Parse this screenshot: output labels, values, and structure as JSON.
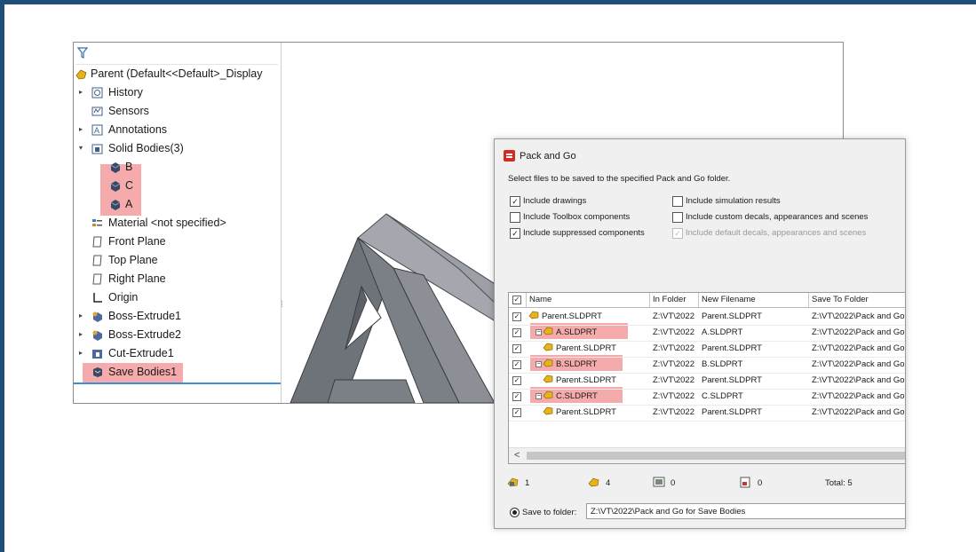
{
  "tree": {
    "parent_label": "Parent  (Default<<Default>_Display",
    "items": [
      {
        "label": "History"
      },
      {
        "label": "Sensors"
      },
      {
        "label": "Annotations"
      },
      {
        "label": "Solid Bodies(3)"
      },
      {
        "label": "B"
      },
      {
        "label": "C"
      },
      {
        "label": "A"
      },
      {
        "label": "Material <not specified>"
      },
      {
        "label": "Front Plane"
      },
      {
        "label": "Top Plane"
      },
      {
        "label": "Right Plane"
      },
      {
        "label": "Origin"
      },
      {
        "label": "Boss-Extrude1"
      },
      {
        "label": "Boss-Extrude2"
      },
      {
        "label": "Cut-Extrude1"
      },
      {
        "label": "Save Bodies1"
      }
    ]
  },
  "dialog": {
    "title": "Pack and Go",
    "instruction": "Select files to be saved to the specified Pack and Go folder.",
    "options": [
      {
        "label": "Include drawings",
        "checked": "✓"
      },
      {
        "label": "Include Toolbox components",
        "checked": ""
      },
      {
        "label": "Include suppressed components",
        "checked": "✓"
      },
      {
        "label": "Include simulation results",
        "checked": ""
      },
      {
        "label": "Include custom decals, appearances and scenes",
        "checked": ""
      },
      {
        "label": "Include default decals, appearances and scenes",
        "checked": "✓"
      }
    ],
    "columns": [
      "Name",
      "In Folder",
      "New Filename",
      "Save To Folder"
    ],
    "header_check": "✓",
    "rows": [
      {
        "name": "Parent.SLDPRT",
        "in_folder": "Z:\\VT\\2022",
        "new_filename": "Parent.SLDPRT",
        "save_to": "Z:\\VT\\2022\\Pack and Go"
      },
      {
        "name": "A.SLDPRT",
        "in_folder": "Z:\\VT\\2022",
        "new_filename": "A.SLDPRT",
        "save_to": "Z:\\VT\\2022\\Pack and Go"
      },
      {
        "name": "Parent.SLDPRT",
        "in_folder": "Z:\\VT\\2022",
        "new_filename": "Parent.SLDPRT",
        "save_to": "Z:\\VT\\2022\\Pack and Go"
      },
      {
        "name": "B.SLDPRT",
        "in_folder": "Z:\\VT\\2022",
        "new_filename": "B.SLDPRT",
        "save_to": "Z:\\VT\\2022\\Pack and Go"
      },
      {
        "name": "Parent.SLDPRT",
        "in_folder": "Z:\\VT\\2022",
        "new_filename": "Parent.SLDPRT",
        "save_to": "Z:\\VT\\2022\\Pack and Go"
      },
      {
        "name": "C.SLDPRT",
        "in_folder": "Z:\\VT\\2022",
        "new_filename": "C.SLDPRT",
        "save_to": "Z:\\VT\\2022\\Pack and Go"
      },
      {
        "name": "Parent.SLDPRT",
        "in_folder": "Z:\\VT\\2022",
        "new_filename": "Parent.SLDPRT",
        "save_to": "Z:\\VT\\2022\\Pack and Go"
      }
    ],
    "scroll_left": "<",
    "summary": {
      "parts": "1",
      "assemblies": "4",
      "drawings": "0",
      "other": "0",
      "total": "Total: 5"
    },
    "save_to_folder_label": "Save to folder:",
    "save_to_folder_value": "Z:\\VT\\2022\\Pack and Go for Save Bodies"
  },
  "colors": {
    "highlight": "#f4a7a7",
    "frame": "#1e4e79",
    "model_face": "#7b7f86"
  }
}
